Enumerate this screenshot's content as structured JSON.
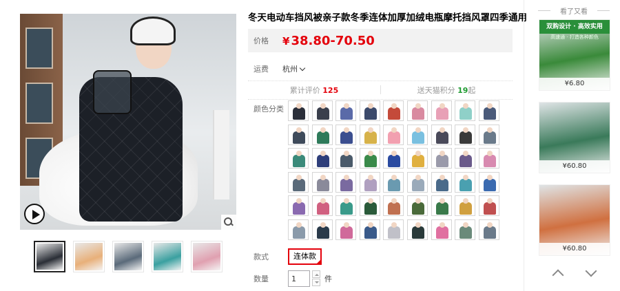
{
  "product": {
    "title": "冬天电动车挡风被亲子款冬季连体加厚加绒电瓶摩托挡风罩四季通用"
  },
  "price": {
    "label": "价格",
    "currency": "¥",
    "value": "38.80-70.50"
  },
  "shipping": {
    "label": "运费",
    "origin": "杭州"
  },
  "stats": {
    "reviews_label": "累计评价",
    "reviews_count": "125",
    "points_label": "送天猫积分",
    "points_value": "19",
    "points_suffix": "起"
  },
  "sku": {
    "color_label": "颜色分类",
    "colors": [
      "#2b2f3a",
      "#3a3f4c",
      "#5a6aa8",
      "#3c4a6b",
      "#c44a3a",
      "#d98aa0",
      "#e8a0b6",
      "#8fd0c8",
      "#4a5a7a",
      "#3e4a5a",
      "#2e7a5a",
      "#3b4e8f",
      "#d7b24a",
      "#f2a0b0",
      "#7ac0e0",
      "#4a4a5a",
      "#3a3a3a",
      "#6a7a8a",
      "#3b8a7a",
      "#2e3e7a",
      "#4a5a6a",
      "#3a8a4a",
      "#2a4aa0",
      "#e0b040",
      "#9a9aaa",
      "#6a5a8a",
      "#d88ab0",
      "#5a6a7a",
      "#8a8a9a",
      "#7a6aa0",
      "#b0a0c0",
      "#6a9ab0",
      "#9aaaba",
      "#4a6a8a",
      "#4aa0b0",
      "#3a6ab0",
      "#8a6ab0",
      "#d06080",
      "#3a9a8a",
      "#2a5a3a",
      "#c07050",
      "#4a6a3a",
      "#3a7a4a",
      "#d0a040",
      "#c05050",
      "#8a9aaa",
      "#2a3a4a",
      "#d06a9a",
      "#3a5a8a",
      "#c0c0c8",
      "#2a3a3a",
      "#e070a0",
      "#6a8a7a",
      "#6a7a8a"
    ],
    "style_label": "款式",
    "style_selected": "连体款",
    "quantity_label": "数量",
    "quantity_value": "1",
    "quantity_unit": "件"
  },
  "gallery": {
    "thumb_colors": [
      "#2a2e36",
      "#e8b07a",
      "#5a6a7a",
      "#3aa0a0",
      "#e0a0b0"
    ]
  },
  "recommend": {
    "title": "看了又看",
    "items": [
      {
        "banner": "双购设计 · 高效实用",
        "banner_sub": "高速通 · 打造各种颜色",
        "price": "¥6.80",
        "bg": "#3a8a3a"
      },
      {
        "price": "¥60.80",
        "bg": "#3a7a5a"
      },
      {
        "price": "¥60.80",
        "bg": "#d07040"
      }
    ]
  }
}
